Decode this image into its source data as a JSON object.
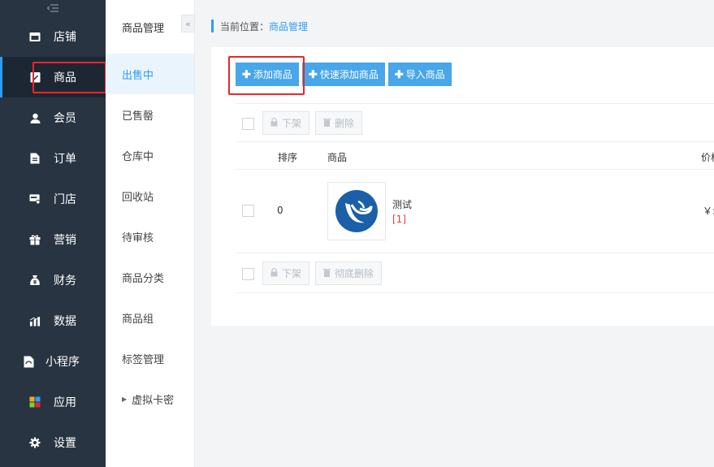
{
  "sidebar": {
    "top_icon": "collapse-lines-icon",
    "items": [
      {
        "label": "店铺",
        "icon": "store-icon"
      },
      {
        "label": "商品",
        "icon": "goods-icon",
        "active": true
      },
      {
        "label": "会员",
        "icon": "user-icon"
      },
      {
        "label": "订单",
        "icon": "order-icon"
      },
      {
        "label": "门店",
        "icon": "shop-icon"
      },
      {
        "label": "营销",
        "icon": "gift-icon"
      },
      {
        "label": "财务",
        "icon": "money-bag-icon"
      },
      {
        "label": "数据",
        "icon": "bar-chart-icon"
      },
      {
        "label": "小程序",
        "icon": "mini-program-icon"
      },
      {
        "label": "应用",
        "icon": "apps-icon"
      },
      {
        "label": "设置",
        "icon": "gear-icon"
      }
    ]
  },
  "submenu": {
    "title": "商品管理",
    "items": [
      {
        "label": "出售中",
        "active": true
      },
      {
        "label": "已售罄"
      },
      {
        "label": "仓库中"
      },
      {
        "label": "回收站"
      },
      {
        "label": "待审核"
      },
      {
        "label": "商品分类"
      },
      {
        "label": "商品组"
      },
      {
        "label": "标签管理"
      },
      {
        "label": "虚拟卡密",
        "expandable": true
      }
    ],
    "collapse_glyph": "«"
  },
  "breadcrumb": {
    "prefix": "当前位置：",
    "current": "商品管理"
  },
  "toolbar": {
    "add_label": "添加商品",
    "quick_add_label": "快速添加商品",
    "import_label": "导入商品",
    "plus": "✚"
  },
  "batch_top": {
    "offshelf_label": "下架",
    "delete_label": "删除"
  },
  "table": {
    "columns": [
      "排序",
      "商品",
      "价格"
    ],
    "rows": [
      {
        "sort": "0",
        "name": "测试",
        "stock": "[1]",
        "price": "￥:"
      }
    ]
  },
  "batch_bottom": {
    "offshelf_label": "下架",
    "delete_label": "彻底删除"
  },
  "colors": {
    "sidebar_bg": "#283442",
    "accent": "#2d9df2",
    "button_blue": "#48a6ea",
    "highlight_red": "#e8262b"
  }
}
